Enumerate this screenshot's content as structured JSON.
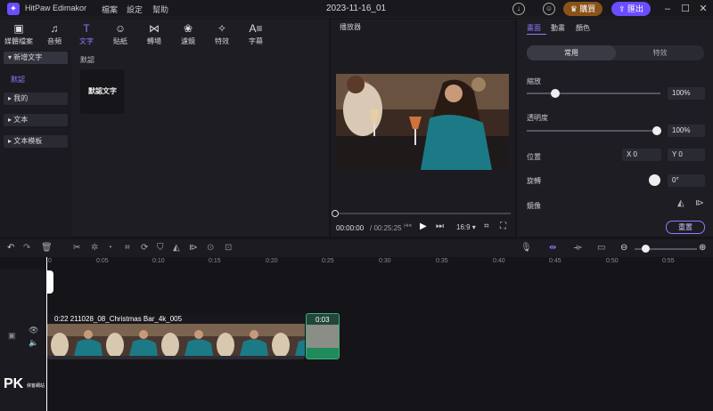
{
  "titlebar": {
    "app_name": "HitPaw Edimakor",
    "menu": [
      "檔案",
      "設定",
      "幫助"
    ],
    "project_name": "2023-11-16_01",
    "buy_label": "購買",
    "export_label": "匯出"
  },
  "top_tabs": [
    {
      "label": "媒體檔案",
      "icon": "media-icon"
    },
    {
      "label": "音頻",
      "icon": "music-note-icon"
    },
    {
      "label": "文字",
      "icon": "text-icon",
      "active": true
    },
    {
      "label": "貼紙",
      "icon": "sticker-icon"
    },
    {
      "label": "轉場",
      "icon": "transition-icon"
    },
    {
      "label": "濾鏡",
      "icon": "filter-icon"
    },
    {
      "label": "特效",
      "icon": "magic-wand-icon"
    },
    {
      "label": "字幕",
      "icon": "subtitle-icon"
    }
  ],
  "categories": {
    "new_text": "新增文字",
    "default_sub": "默認",
    "items": [
      "我的",
      "文本",
      "文本模板"
    ]
  },
  "content": {
    "section_title": "默認",
    "card_label": "默認文字"
  },
  "player": {
    "title": "播放器",
    "current_time": "00:00:00",
    "total_time": "/ 00:25:25",
    "aspect": "16:9 ▾"
  },
  "right_panel": {
    "tabs": [
      "畫面",
      "動畫",
      "顏色"
    ],
    "seg_common": "常用",
    "seg_effect": "特效",
    "scale_label": "縮放",
    "scale_value": "100%",
    "opacity_label": "透明度",
    "opacity_value": "100%",
    "position_label": "位置",
    "pos_x": "X 0",
    "pos_y": "Y 0",
    "rotate_label": "旋轉",
    "rotate_value": "0°",
    "mirror_label": "鏡像",
    "reset_label": "重置",
    "scale_level": 0.21,
    "opacity_level": 0.97
  },
  "timeline": {
    "ticks": [
      "0",
      "0:05",
      "0:10",
      "0:15",
      "0:20",
      "0:25",
      "0:30",
      "0:35",
      "0:40",
      "0:45",
      "0:50",
      "0:55"
    ],
    "main_clip_label": "0:22   211028_08_Christmas Bar_4k_005",
    "small_clip_label": "0:03"
  },
  "watermark": {
    "logo": "PK",
    "sub": "俠客網站"
  },
  "colors": {
    "accent": "#8f7bff",
    "buy": "#a66420",
    "export": "#6b4cff"
  }
}
